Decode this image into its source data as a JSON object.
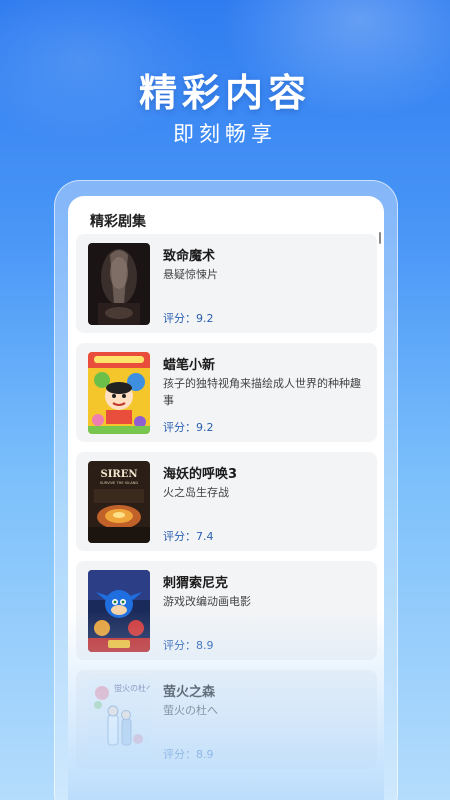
{
  "promo": {
    "headline": "精彩内容",
    "subheadline": "即刻畅享"
  },
  "screen": {
    "section_title": "精彩剧集",
    "items": [
      {
        "title": "致命魔术",
        "desc": "悬疑惊悚片",
        "score": "评分：9.2",
        "poster_icon": "poster-the-prestige"
      },
      {
        "title": "蜡笔小新",
        "desc": "孩子的独特视角来描绘成人世界的种种趣事",
        "score": "评分：9.2",
        "poster_icon": "poster-crayon-shinchan"
      },
      {
        "title": "海妖的呼唤3",
        "desc": "火之岛生存战",
        "score": "评分：7.4",
        "poster_icon": "poster-siren"
      },
      {
        "title": "刺猬索尼克",
        "desc": "游戏改编动画电影",
        "score": "评分：8.9",
        "poster_icon": "poster-sonic"
      },
      {
        "title": "萤火之森",
        "desc": "萤火の杜へ",
        "score": "评分：8.9",
        "poster_icon": "poster-hotarubi"
      }
    ],
    "poster_texts": {
      "siren_title": "SIREN",
      "siren_sub": "SURVIVE THE ISLAND",
      "hotarubi_title": "蛍火の杜へ"
    }
  }
}
